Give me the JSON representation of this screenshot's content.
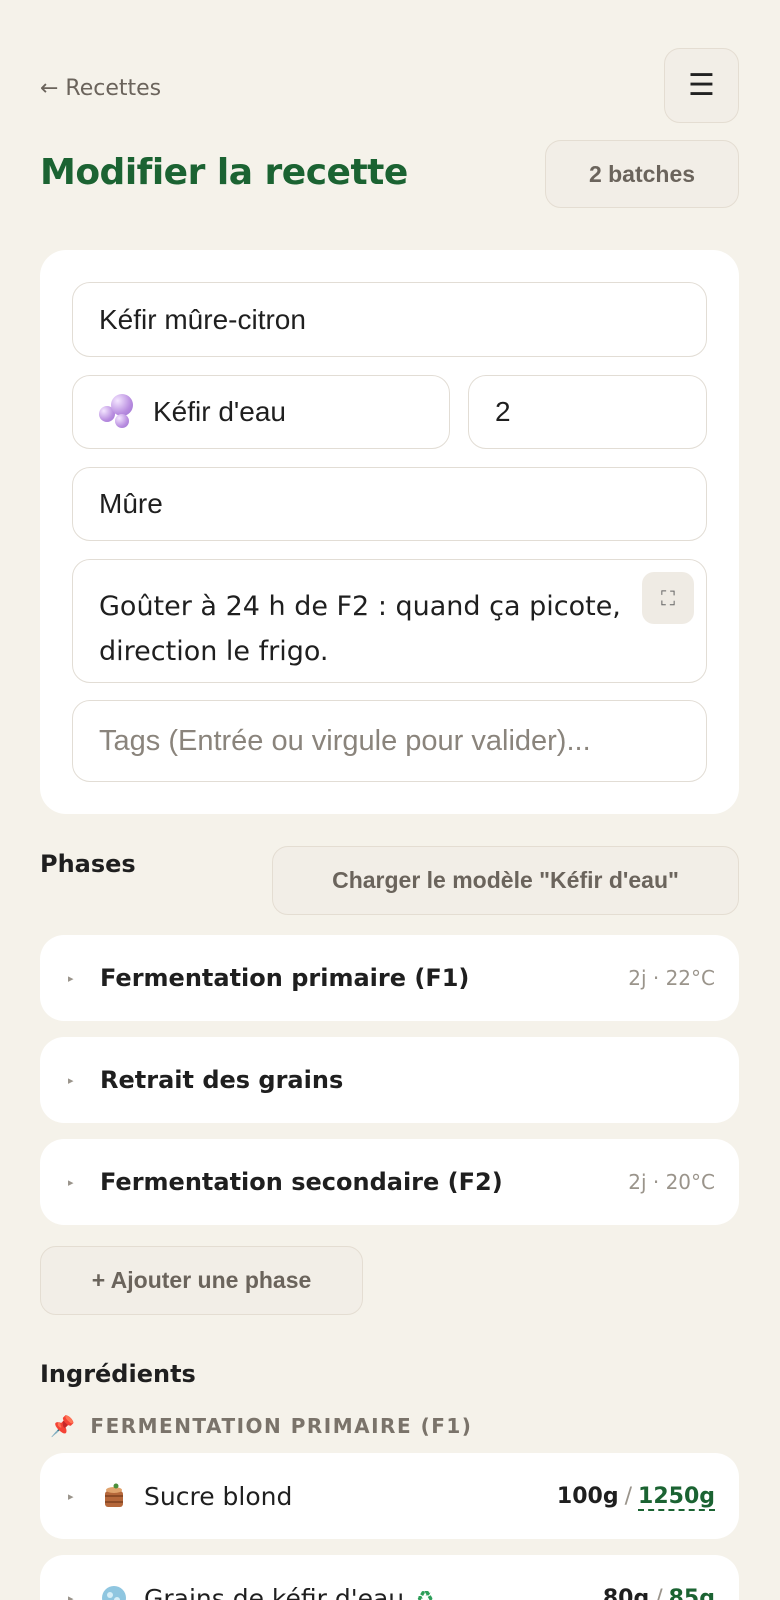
{
  "nav": {
    "back_label": "← Recettes",
    "menu_icon": "hamburger-icon"
  },
  "header": {
    "title": "Modifier la recette",
    "batches_label": "2 batches"
  },
  "form": {
    "name_value": "Kéfir mûre-citron",
    "type_value": "Kéfir d'eau",
    "type_icon": "bubbles-icon",
    "quantity_value": "2",
    "fruit_value": "Mûre",
    "notes_value": "Goûter à 24 h de F2 : quand ça picote, direction le frigo.",
    "tags_placeholder": "Tags (Entrée ou virgule pour valider)..."
  },
  "phases": {
    "title": "Phases",
    "load_template_label": "Charger le modèle \"Kéfir d'eau\"",
    "items": [
      {
        "label": "Fermentation primaire (F1)",
        "meta": "2j · 22°C"
      },
      {
        "label": "Retrait des grains",
        "meta": ""
      },
      {
        "label": "Fermentation secondaire (F2)",
        "meta": "2j · 20°C"
      }
    ],
    "add_label": "+ Ajouter une phase"
  },
  "ingredients": {
    "title": "Ingrédients",
    "group_label": "FERMENTATION PRIMAIRE (F1)",
    "items": [
      {
        "label": "Sucre blond",
        "amount": "100g",
        "total": "1250g",
        "icon": "sugar-pot-icon"
      },
      {
        "label": "Grains de kéfir d'eau",
        "amount": "80g",
        "total": "85g",
        "icon": "kefir-grains-icon"
      }
    ]
  },
  "colors": {
    "accent": "#1b6332",
    "background": "#f5f2ea"
  }
}
